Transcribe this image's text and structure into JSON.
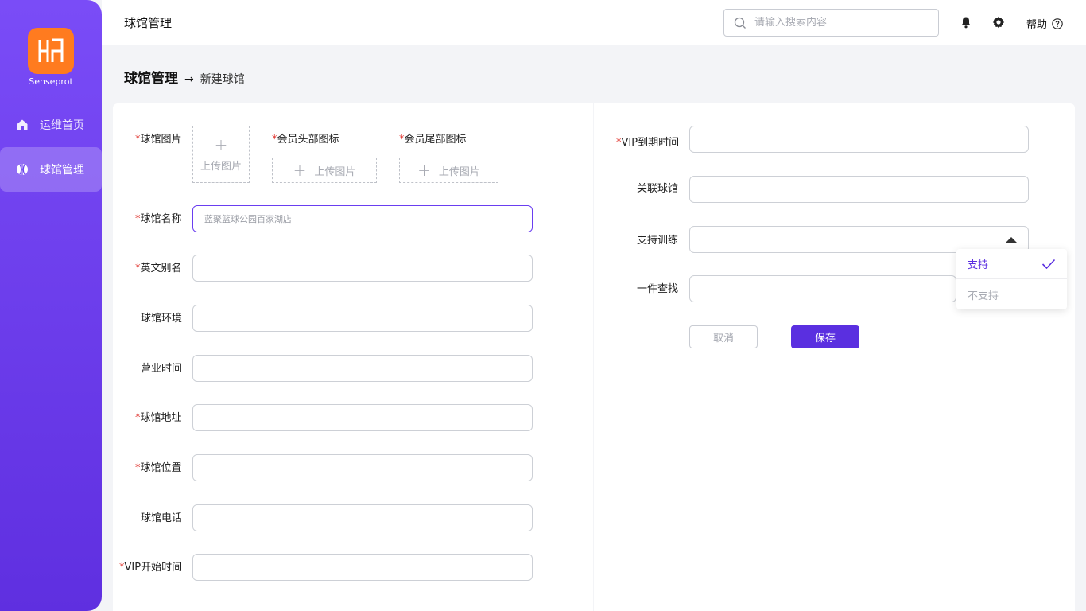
{
  "brand": {
    "name": "Senseprot",
    "color": "#ff7b1f"
  },
  "sidebar": {
    "items": [
      {
        "label": "运维首页",
        "icon": "home-icon",
        "active": false
      },
      {
        "label": "球馆管理",
        "icon": "basketball-icon",
        "active": true
      }
    ]
  },
  "header": {
    "title": "球馆管理",
    "search_placeholder": "请输入搜索内容",
    "help_label": "帮助"
  },
  "breadcrumb": {
    "parent": "球馆管理",
    "separator": "→",
    "current": "新建球馆"
  },
  "form_left": {
    "venue_image_label": "球馆图片",
    "member_head_icon_label": "会员头部图标",
    "member_tail_icon_label": "会员尾部图标",
    "upload_label": "上传图片",
    "name_label": "球馆名称",
    "name_placeholder": "蓝聚篮球公园百家湖店",
    "english_alias_label": "英文别名",
    "environment_label": "球馆环境",
    "business_hours_label": "营业时间",
    "address_label": "球馆地址",
    "location_label": "球馆位置",
    "phone_label": "球馆电话",
    "vip_start_label": "VIP开始时间"
  },
  "form_right": {
    "vip_end_label": "VIP到期时间",
    "linked_venue_label": "关联球馆",
    "support_training_label": "支持训练",
    "one_click_search_label": "一件查找",
    "dropdown_options": [
      {
        "label": "支持",
        "selected": true
      },
      {
        "label": "不支持",
        "selected": false
      }
    ],
    "cancel_label": "取消",
    "save_label": "保存"
  },
  "colors": {
    "accent": "#5a2fe0",
    "required": "#e0312b",
    "sidebar": "#6a3ef0"
  },
  "required_mark": "*"
}
